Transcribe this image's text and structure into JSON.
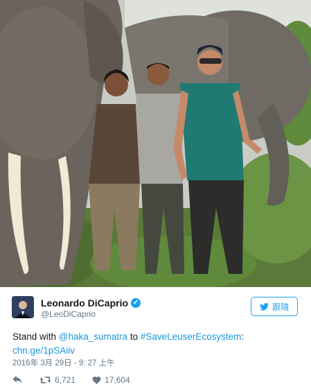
{
  "colors": {
    "accent": "#1da1f2",
    "link": "#1b95e0",
    "text": "#14171a",
    "muted": "#657786"
  },
  "user": {
    "name": "Leonardo DiCaprio",
    "handle": "@LeoDiCaprio",
    "verified_icon": "verified-badge-icon"
  },
  "follow_button": {
    "label": "跟隨",
    "icon": "twitter-bird-icon"
  },
  "tweet": {
    "text_1": "Stand with ",
    "mention": "@haka_sumatra",
    "text_2": " to ",
    "hashtag": "#SaveLeuserEcosystem",
    "text_3": ":",
    "link": "chn.ge/1pSAiiv"
  },
  "timestamp": "2016年 3月 29日 - 9: 27 上午",
  "actions": {
    "reply_icon": "reply-icon",
    "retweet_icon": "retweet-icon",
    "retweet_count": "6,721",
    "like_icon": "heart-icon",
    "like_count": "17,604"
  }
}
